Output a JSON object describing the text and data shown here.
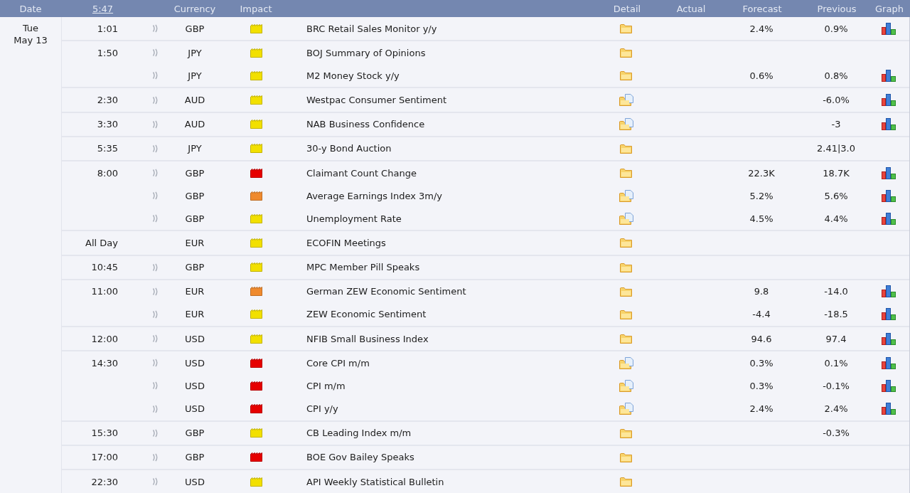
{
  "header": {
    "columns": [
      "Date",
      "5:47",
      "Currency",
      "Impact",
      "Detail",
      "Actual",
      "Forecast",
      "Previous",
      "Graph"
    ]
  },
  "day": {
    "weekday": "Tue",
    "date": "May 13"
  },
  "events": [
    {
      "time": "1:01",
      "sound": true,
      "currency": "GBP",
      "impact": {
        "color": "#f2e000"
      },
      "event": "BRC Retail Sales Monitor y/y",
      "has_document": false,
      "forecast": "2.4%",
      "previous": "0.9%",
      "graph": true
    },
    {
      "time": "1:50",
      "sound": true,
      "currency": "JPY",
      "impact": {
        "color": "#f2e000"
      },
      "event": "BOJ Summary of Opinions",
      "has_document": false,
      "graph": false
    },
    {
      "sound": true,
      "currency": "JPY",
      "impact": {
        "color": "#f2e000"
      },
      "event": "M2 Money Stock y/y",
      "has_document": false,
      "forecast": "0.6%",
      "previous": "0.8%",
      "graph": true
    },
    {
      "time": "2:30",
      "sound": true,
      "currency": "AUD",
      "impact": {
        "color": "#f2e000"
      },
      "event": "Westpac Consumer Sentiment",
      "has_document": true,
      "previous": "-6.0%",
      "graph": true
    },
    {
      "time": "3:30",
      "sound": true,
      "currency": "AUD",
      "impact": {
        "color": "#f2e000"
      },
      "event": "NAB Business Confidence",
      "has_document": true,
      "previous": "-3",
      "graph": true
    },
    {
      "time": "5:35",
      "sound": true,
      "currency": "JPY",
      "impact": {
        "color": "#f2e000"
      },
      "event": "30-y Bond Auction",
      "has_document": false,
      "previous": "2.41|3.0",
      "graph": false
    },
    {
      "time": "8:00",
      "sound": true,
      "currency": "GBP",
      "impact": {
        "color": "#e60000"
      },
      "event": "Claimant Count Change",
      "has_document": false,
      "forecast": "22.3K",
      "previous": "18.7K",
      "graph": true
    },
    {
      "sound": true,
      "currency": "GBP",
      "impact": {
        "color": "#ef8a2e"
      },
      "event": "Average Earnings Index 3m/y",
      "has_document": true,
      "forecast": "5.2%",
      "previous": "5.6%",
      "graph": true
    },
    {
      "sound": true,
      "currency": "GBP",
      "impact": {
        "color": "#f2e000"
      },
      "event": "Unemployment Rate",
      "has_document": true,
      "forecast": "4.5%",
      "previous": "4.4%",
      "graph": true
    },
    {
      "time": "All Day",
      "sound": false,
      "currency": "EUR",
      "impact": {
        "color": "#f2e000"
      },
      "event": "ECOFIN Meetings",
      "has_document": false,
      "graph": false
    },
    {
      "time": "10:45",
      "sound": true,
      "currency": "GBP",
      "impact": {
        "color": "#f2e000"
      },
      "event": "MPC Member Pill Speaks",
      "has_document": false,
      "graph": false
    },
    {
      "time": "11:00",
      "sound": true,
      "currency": "EUR",
      "impact": {
        "color": "#ef8a2e"
      },
      "event": "German ZEW Economic Sentiment",
      "has_document": false,
      "forecast": "9.8",
      "previous": "-14.0",
      "graph": true
    },
    {
      "sound": true,
      "currency": "EUR",
      "impact": {
        "color": "#f2e000"
      },
      "event": "ZEW Economic Sentiment",
      "has_document": false,
      "forecast": "-4.4",
      "previous": "-18.5",
      "graph": true
    },
    {
      "time": "12:00",
      "sound": true,
      "currency": "USD",
      "impact": {
        "color": "#f2e000"
      },
      "event": "NFIB Small Business Index",
      "has_document": false,
      "forecast": "94.6",
      "previous": "97.4",
      "graph": true
    },
    {
      "time": "14:30",
      "sound": true,
      "currency": "USD",
      "impact": {
        "color": "#e60000"
      },
      "event": "Core CPI m/m",
      "has_document": true,
      "forecast": "0.3%",
      "previous": "0.1%",
      "graph": true
    },
    {
      "sound": true,
      "currency": "USD",
      "impact": {
        "color": "#e60000"
      },
      "event": "CPI m/m",
      "has_document": true,
      "forecast": "0.3%",
      "previous": "-0.1%",
      "graph": true
    },
    {
      "sound": true,
      "currency": "USD",
      "impact": {
        "color": "#e60000"
      },
      "event": "CPI y/y",
      "has_document": true,
      "forecast": "2.4%",
      "previous": "2.4%",
      "graph": true
    },
    {
      "time": "15:30",
      "sound": true,
      "currency": "GBP",
      "impact": {
        "color": "#f2e000"
      },
      "event": "CB Leading Index m/m",
      "has_document": false,
      "previous": "-0.3%",
      "graph": false
    },
    {
      "time": "17:00",
      "sound": true,
      "currency": "GBP",
      "impact": {
        "color": "#e60000"
      },
      "event": "BOE Gov Bailey Speaks",
      "has_document": false,
      "graph": false
    },
    {
      "time": "22:30",
      "sound": true,
      "currency": "USD",
      "impact": {
        "color": "#f2e000"
      },
      "event": "API Weekly Statistical Bulletin",
      "has_document": false,
      "graph": false
    }
  ]
}
